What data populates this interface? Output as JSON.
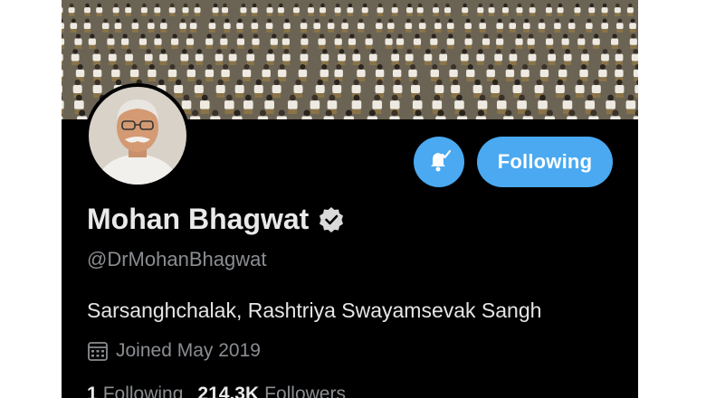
{
  "profile": {
    "display_name": "Mohan Bhagwat",
    "handle": "@DrMohanBhagwat",
    "bio": "Sarsanghchalak, Rashtriya Swayamsevak Sangh",
    "joined": "Joined May 2019",
    "verified": true
  },
  "actions": {
    "notifications_icon": "bell-check-icon",
    "following_label": "Following"
  },
  "stats": {
    "following_count": "1",
    "following_label": "Following",
    "followers_count": "214.3K",
    "followers_label": "Followers"
  },
  "colors": {
    "accent": "#4aa9f0",
    "background": "#000000",
    "secondary_text": "#8a8d91",
    "primary_text": "#e9e9e9"
  }
}
